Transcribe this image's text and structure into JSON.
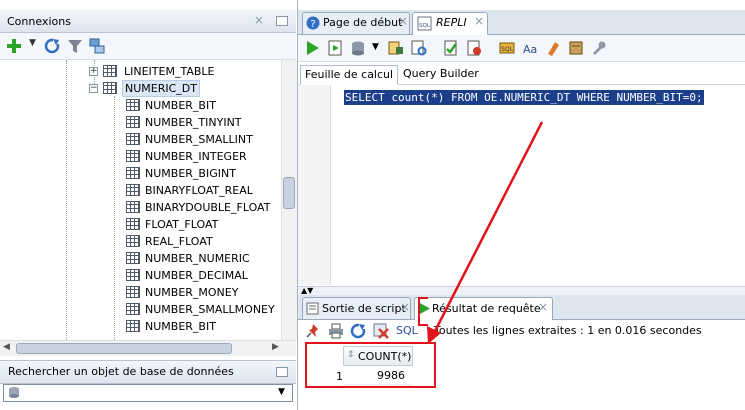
{
  "connections_panel": {
    "title": "Connexions",
    "tree": {
      "items": [
        {
          "label": "LINEITEM_TABLE",
          "expander": "+"
        },
        {
          "label": "NUMERIC_DT",
          "expander": "−"
        },
        {
          "label": "NUMBER_BIT"
        },
        {
          "label": "NUMBER_TINYINT"
        },
        {
          "label": "NUMBER_SMALLINT"
        },
        {
          "label": "NUMBER_INTEGER"
        },
        {
          "label": "NUMBER_BIGINT"
        },
        {
          "label": "BINARYFLOAT_REAL"
        },
        {
          "label": "BINARYDOUBLE_FLOAT"
        },
        {
          "label": "FLOAT_FLOAT"
        },
        {
          "label": "REAL_FLOAT"
        },
        {
          "label": "NUMBER_NUMERIC"
        },
        {
          "label": "NUMBER_DECIMAL"
        },
        {
          "label": "NUMBER_MONEY"
        },
        {
          "label": "NUMBER_SMALLMONEY"
        },
        {
          "label": "NUMBER_BIT"
        }
      ]
    }
  },
  "search_panel": {
    "title": "Rechercher un objet de base de données"
  },
  "doc_tabs": [
    {
      "label": "Page de début"
    },
    {
      "label": "REPLI"
    }
  ],
  "worksheet": {
    "subtabs": [
      {
        "label": "Feuille de calcul"
      },
      {
        "label": "Query Builder"
      }
    ],
    "sql": "SELECT count(*) FROM OE.NUMERIC_DT WHERE NUMBER_BIT=0;"
  },
  "output": {
    "tabs": [
      {
        "label": "Sortie de script"
      },
      {
        "label": "Résultat de requête"
      }
    ],
    "sql_label": "SQL",
    "status": "Toutes les lignes extraites : 1 en 0.016 secondes",
    "grid": {
      "columns": [
        "COUNT(*)"
      ],
      "rows": [
        {
          "num": "1",
          "values": [
            "9986"
          ]
        }
      ]
    }
  },
  "colors": {
    "selection": "#1c3f8c",
    "annotation": "#e0141a",
    "accent_green": "#2aa52a"
  }
}
